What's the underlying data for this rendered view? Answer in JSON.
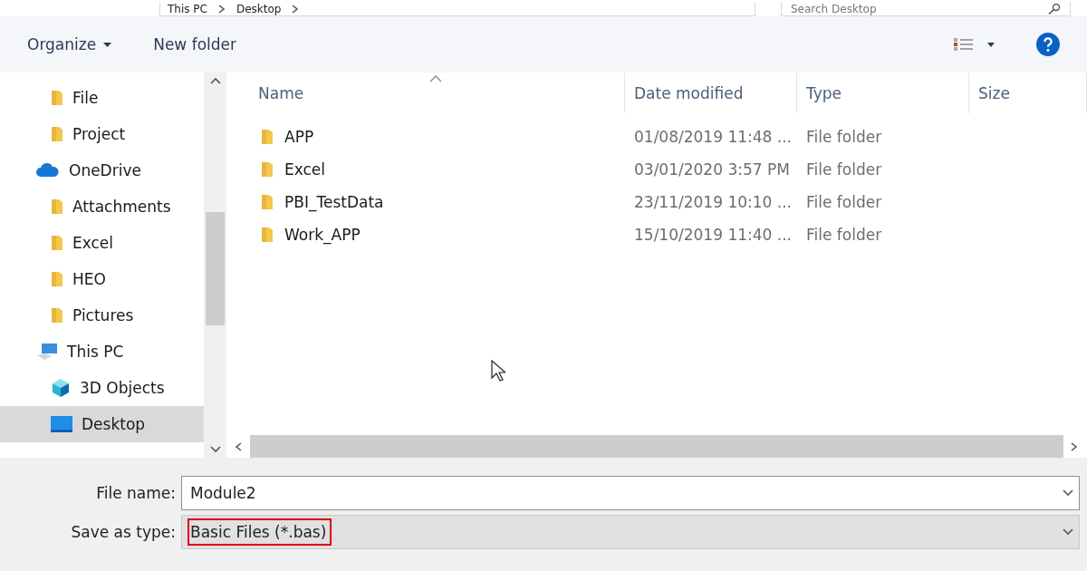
{
  "address_bar": {
    "crumbs": [
      "This PC",
      "Desktop"
    ],
    "search": {
      "placeholder": "Search Desktop"
    }
  },
  "toolbar": {
    "organize": "Organize",
    "new_folder": "New folder"
  },
  "nav": {
    "items": [
      {
        "label": "File",
        "kind": "folder",
        "selected": false
      },
      {
        "label": "Project",
        "kind": "folder",
        "selected": false
      },
      {
        "label": "OneDrive",
        "kind": "cloud",
        "selected": false,
        "children": [
          {
            "label": "Attachments",
            "kind": "folder",
            "selected": false
          },
          {
            "label": "Excel",
            "kind": "folder",
            "selected": false
          },
          {
            "label": "HEO",
            "kind": "folder",
            "selected": false
          },
          {
            "label": "Pictures",
            "kind": "folder",
            "selected": false
          }
        ]
      },
      {
        "label": "This PC",
        "kind": "pc",
        "selected": false,
        "children": [
          {
            "label": "3D Objects",
            "kind": "cube",
            "selected": false
          },
          {
            "label": "Desktop",
            "kind": "desktop",
            "selected": true
          }
        ]
      }
    ]
  },
  "table": {
    "columns": [
      "Name",
      "Date modified",
      "Type",
      "Size"
    ],
    "rows": [
      {
        "name": "APP",
        "date": "01/08/2019 11:48 ...",
        "type": "File folder"
      },
      {
        "name": "Excel",
        "date": "03/01/2020 3:57 PM",
        "type": "File folder"
      },
      {
        "name": "PBI_TestData",
        "date": "23/11/2019 10:10 ...",
        "type": "File folder"
      },
      {
        "name": "Work_APP",
        "date": "15/10/2019 11:40 ...",
        "type": "File folder"
      }
    ]
  },
  "form": {
    "file_name": {
      "label": "File name:",
      "value": "Module2"
    },
    "save_as_type": {
      "label": "Save as type:",
      "value": "Basic Files (*.bas)",
      "highlighted": true
    }
  }
}
